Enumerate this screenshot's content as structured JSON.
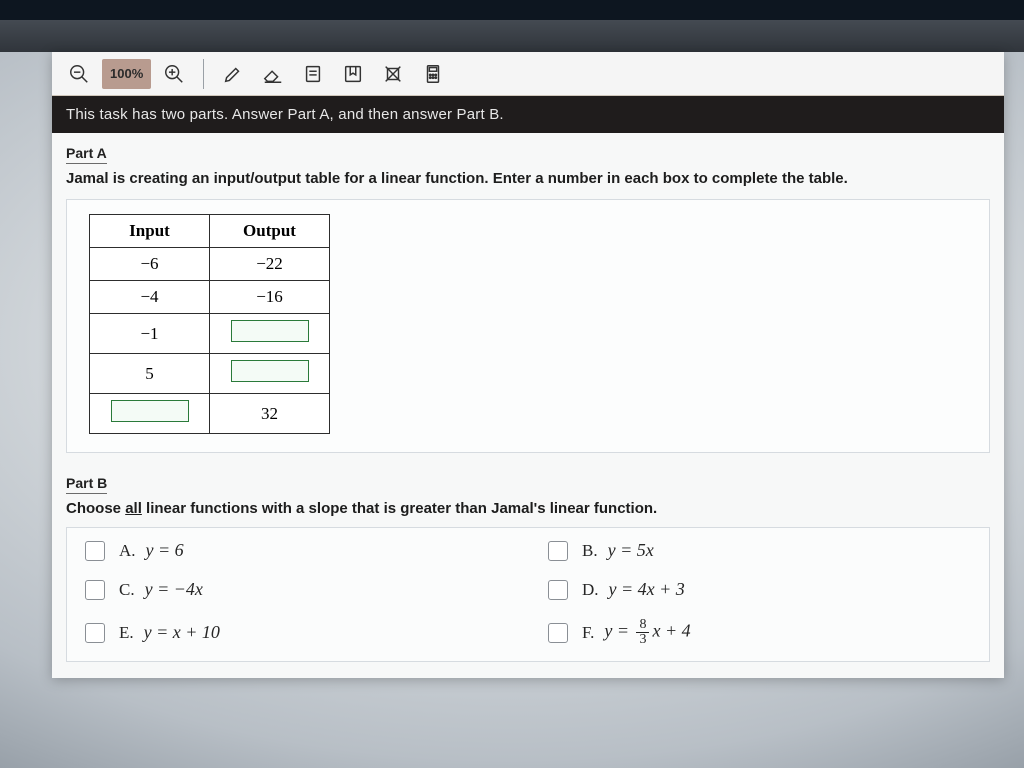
{
  "toolbar": {
    "zoom_pct": "100%"
  },
  "instruction_bar": "This task has two parts. Answer Part A, and then answer Part B.",
  "partA": {
    "heading": "Part A",
    "prompt": "Jamal is creating an input/output table for a linear function. Enter a number in each box to complete the table.",
    "table": {
      "headers": {
        "input": "Input",
        "output": "Output"
      },
      "rows": [
        {
          "input": "−6",
          "output": "−22"
        },
        {
          "input": "−4",
          "output": "−16"
        },
        {
          "input": "−1",
          "output": ""
        },
        {
          "input": "5",
          "output": ""
        },
        {
          "input": "",
          "output": "32"
        }
      ]
    }
  },
  "partB": {
    "heading": "Part B",
    "prompt_pre": "Choose ",
    "prompt_underlined": "all",
    "prompt_post": " linear functions with a slope that is greater than Jamal's linear function.",
    "choices": {
      "A": {
        "letter": "A.",
        "text": "y = 6"
      },
      "B": {
        "letter": "B.",
        "text": "y = 5x"
      },
      "C": {
        "letter": "C.",
        "text": "y = −4x"
      },
      "D": {
        "letter": "D.",
        "text": "y = 4x + 3"
      },
      "E": {
        "letter": "E.",
        "text": "y = x + 10"
      },
      "F": {
        "letter": "F.",
        "text_pre": "y = ",
        "frac_num": "8",
        "frac_den": "3",
        "text_post": "x + 4"
      }
    }
  }
}
